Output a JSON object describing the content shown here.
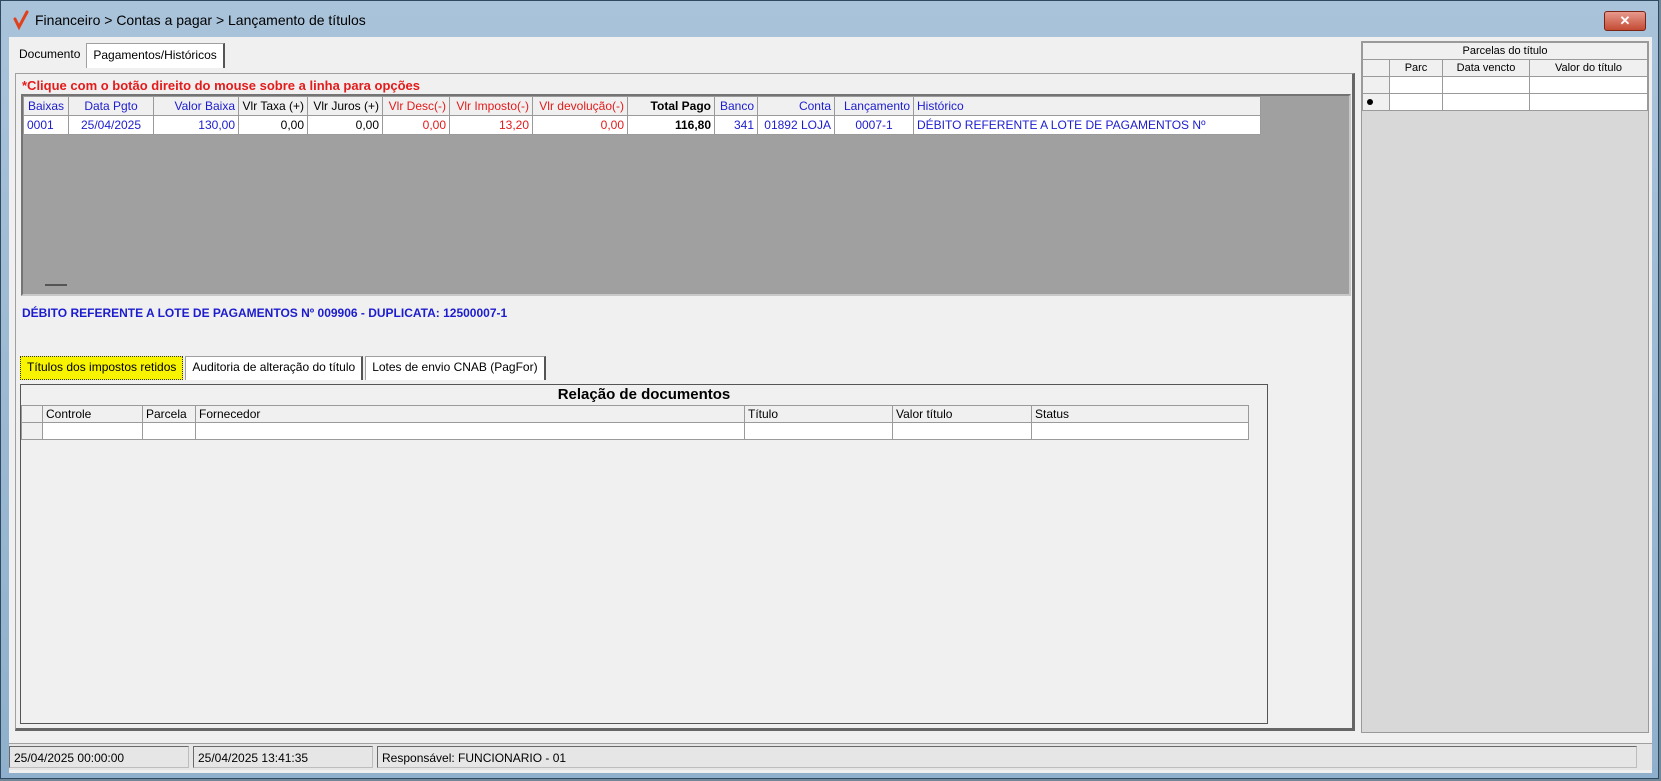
{
  "window": {
    "title": "Financeiro > Contas a pagar > Lançamento de títulos",
    "close_label": "✕"
  },
  "main_tabs": [
    {
      "label": "Documento"
    },
    {
      "label": "Pagamentos/Históricos"
    }
  ],
  "payments": {
    "hint": "*Clique com o botão direito do mouse sobre a linha para opções",
    "columns": [
      "Baixas",
      "Data Pgto",
      "Valor Baixa",
      "Vlr Taxa (+)",
      "Vlr Juros (+)",
      "Vlr Desc(-)",
      "Vlr Imposto(-)",
      "Vlr devolução(-)",
      "Total Pago",
      "Banco",
      "Conta",
      "Lançamento",
      "Histórico"
    ],
    "rows": [
      {
        "baixa": "0001",
        "data": "25/04/2025",
        "valor": "130,00",
        "taxa": "0,00",
        "juros": "0,00",
        "desc": "0,00",
        "imposto": "13,20",
        "devolucao": "0,00",
        "total": "116,80",
        "banco": "341",
        "conta": "01892 LOJA",
        "lancamento": "0007-1",
        "historico": "DÉBITO REFERENTE A LOTE DE PAGAMENTOS Nº"
      }
    ],
    "history_text": "DÉBITO REFERENTE A LOTE DE PAGAMENTOS Nº 009906 - DUPLICATA: 12500007-1"
  },
  "sub_tabs": [
    {
      "label": "Títulos dos impostos retidos"
    },
    {
      "label": "Auditoria de alteração do título"
    },
    {
      "label": "Lotes de envio CNAB (PagFor)"
    }
  ],
  "documents": {
    "title": "Relação de documentos",
    "columns": [
      "Controle",
      "Parcela",
      "Fornecedor",
      "Título",
      "Valor título",
      "Status"
    ]
  },
  "parcelas": {
    "title": "Parcelas do título",
    "columns": [
      "Parc",
      "Data vencto",
      "Valor do título"
    ]
  },
  "status_bar": {
    "created": "25/04/2025 00:00:00",
    "modified": "25/04/2025 13:41:35",
    "responsavel": "Responsável: FUNCIONARIO - 01"
  },
  "colors": {
    "link_blue": "#1c1ccf",
    "alert_red": "#e31b1b",
    "active_tab_yellow": "#f8f400"
  }
}
